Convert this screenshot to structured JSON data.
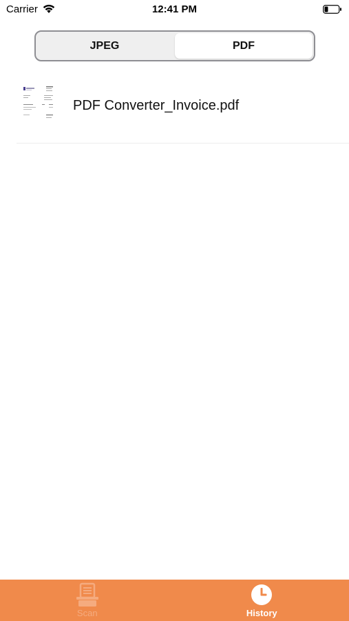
{
  "status_bar": {
    "carrier": "Carrier",
    "time": "12:41 PM",
    "wifi_icon": "wifi-icon",
    "battery_icon": "battery-icon"
  },
  "segmented_control": {
    "options": [
      "JPEG",
      "PDF"
    ],
    "selected": "PDF"
  },
  "history_list": {
    "items": [
      {
        "file_name": "PDF Converter_Invoice.pdf",
        "thumbnail_icon": "document-thumbnail"
      }
    ]
  },
  "tab_bar": {
    "background_color": "#f08a4b",
    "tabs": [
      {
        "label": "Scan",
        "icon": "scanner-icon",
        "active": false
      },
      {
        "label": "History",
        "icon": "clock-icon",
        "active": true
      }
    ]
  }
}
